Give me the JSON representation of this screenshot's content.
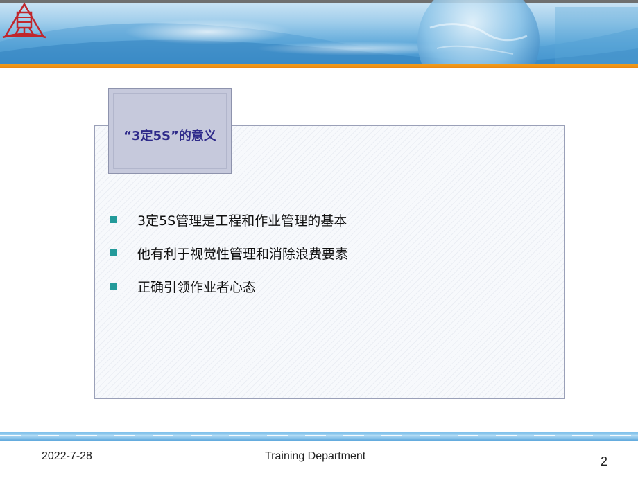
{
  "slide": {
    "title": "“3定5S”的意义",
    "bullets": [
      "3定5S管理是工程和作业管理的基本",
      "他有利于视觉性管理和消除浪费要素",
      "正确引领作业者心态"
    ]
  },
  "footer": {
    "date": "2022-7-28",
    "department": "Training Department",
    "page_number": "2"
  },
  "colors": {
    "accent_orange": "#e88612",
    "banner_blue": "#3c8fcb",
    "title_text": "#2e2a8a",
    "bullet_square": "#239a9a",
    "logo_red": "#c0262c"
  },
  "icons": {
    "logo": "company-logo-icon",
    "bullet": "square-bullet-icon"
  }
}
